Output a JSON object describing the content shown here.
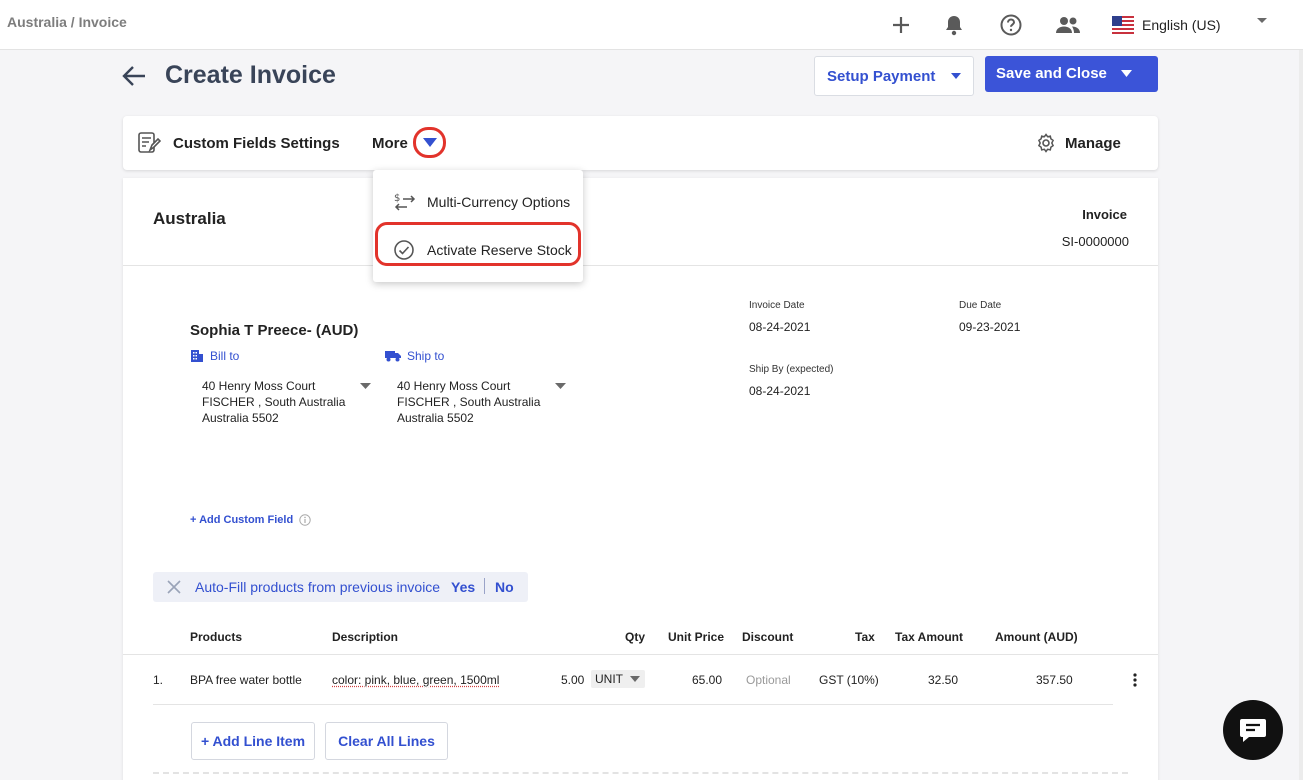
{
  "topbar": {
    "breadcrumb": "Australia / Invoice",
    "icons": [
      "plus-icon",
      "bell-icon",
      "help-icon",
      "users-icon"
    ],
    "language": {
      "label": "English (US)",
      "flag": "us-flag-icon"
    }
  },
  "header": {
    "title": "Create Invoice",
    "setup_payment": "Setup Payment",
    "save_and_close": "Save and Close",
    "accent": "#3b54d8"
  },
  "toolbar": {
    "custom_fields": "Custom Fields Settings",
    "more": "More",
    "manage": "Manage"
  },
  "menu": {
    "items": [
      {
        "label": "Multi-Currency Options",
        "icon": "currency-exchange-icon"
      },
      {
        "label": "Activate Reserve Stock",
        "icon": "check-circle-icon"
      }
    ],
    "highlight_color": "#e2332b"
  },
  "invoice": {
    "company": "Australia",
    "doc_type": "Invoice",
    "number": "SI-0000000",
    "customer": "Sophia T Preece- (AUD)",
    "bill_to": {
      "label": "Bill to",
      "lines": [
        "40 Henry Moss Court",
        "FISCHER , South Australia",
        "Australia 5502"
      ]
    },
    "ship_to": {
      "label": "Ship to",
      "lines": [
        "40 Henry Moss Court",
        "FISCHER , South Australia",
        "Australia 5502"
      ]
    },
    "invoice_date_label": "Invoice Date",
    "invoice_date": "08-24-2021",
    "due_date_label": "Due Date",
    "due_date": "09-23-2021",
    "ship_by_label": "Ship By (expected)",
    "ship_by": "08-24-2021",
    "add_custom_field": "+ Add Custom Field"
  },
  "autofill": {
    "text": "Auto-Fill products from previous invoice",
    "yes": "Yes",
    "no": "No"
  },
  "table": {
    "headers": {
      "products": "Products",
      "description": "Description",
      "qty": "Qty",
      "unit_price": "Unit Price",
      "discount": "Discount",
      "tax": "Tax",
      "tax_amount": "Tax Amount",
      "amount": "Amount (AUD)"
    },
    "rows": [
      {
        "index": "1.",
        "product": "BPA free water bottle",
        "description": "color: pink, blue, green, 1500ml",
        "qty": "5.00",
        "unit": "UNIT",
        "unit_price": "65.00",
        "discount": "Optional",
        "tax": "GST (10%)",
        "tax_amount": "32.50",
        "amount": "357.50"
      }
    ],
    "add_line_item": "+ Add Line Item",
    "clear_all_lines": "Clear All Lines"
  }
}
